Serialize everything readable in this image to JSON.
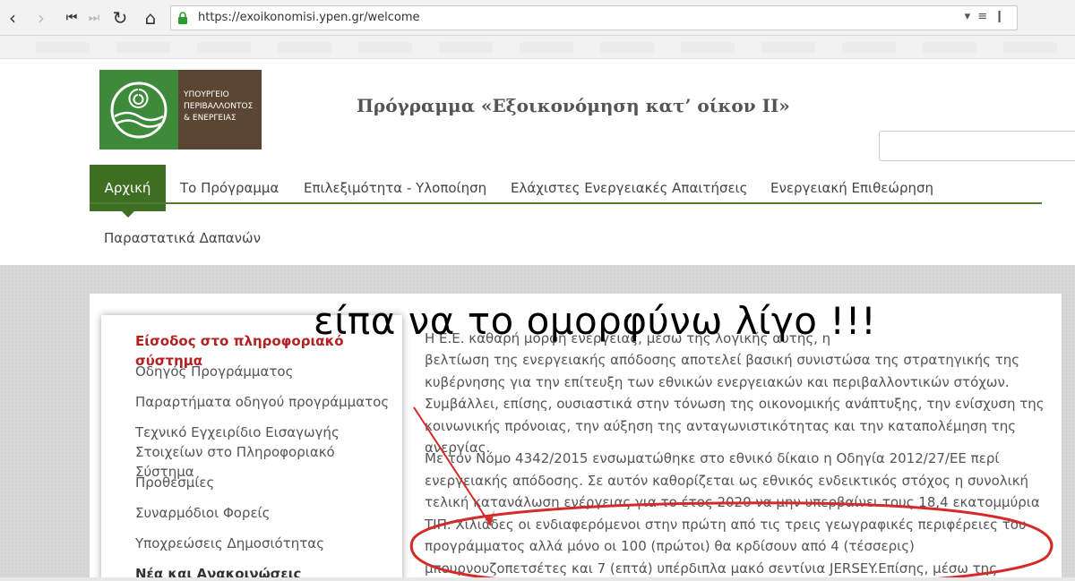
{
  "browser": {
    "url": "https://exoikonomisi.ypen.gr/welcome",
    "back_icon": "chevron-left-icon",
    "forward_icon": "chevron-right-icon"
  },
  "logo": {
    "line1": "ΥΠΟΥΡΓΕΙΟ",
    "line2": "ΠΕΡΙΒΑΛΛΟΝΤΟΣ",
    "line3": "& ΕΝΕΡΓΕΙΑΣ"
  },
  "site": {
    "title": "Πρόγραμμα «Εξοικονόμηση κατ’ οίκον ΙΙ»"
  },
  "menu": [
    {
      "label": "Αρχική",
      "active": true
    },
    {
      "label": "Το Πρόγραμμα"
    },
    {
      "label": "Επιλεξιμότητα - Υλοποίηση"
    },
    {
      "label": "Ελάχιστες Ενεργειακές Απαιτήσεις"
    },
    {
      "label": "Ενεργειακή Επιθεώρηση"
    },
    {
      "label": "Παραστατικά Δαπανών"
    }
  ],
  "sidebar": [
    {
      "label": "Είσοδος στο πληροφοριακό σύστημα",
      "active": true
    },
    {
      "label": "Οδηγός Προγράμματος"
    },
    {
      "label": "Παραρτήματα οδηγού προγράμματος"
    },
    {
      "label": "Τεχνικό Εγχειρίδιο Εισαγωγής Στοιχείων στο Πληροφοριακό Σύστημα"
    },
    {
      "label": "Προθεσμίες"
    },
    {
      "label": "Συναρμόδιοι Φορείς"
    },
    {
      "label": "Υποχρεώσεις Δημοσιότητας"
    },
    {
      "label": "Νέα και Ανακοινώσεις"
    }
  ],
  "content": {
    "p1_line1": "Η Ε.Ε. καθαρή μορφή ενέργειας, μέσω της λογικής αυτής, η",
    "p1_rest": "βελτίωση της ενεργειακής απόδοσης αποτελεί βασική συνιστώσα της στρατηγικής της κυβέρνησης για την επίτευξη των εθνικών ενεργειακών και περιβαλλοντικών στόχων. Συμβάλλει, επίσης, ουσιαστικά στην τόνωση της οικονομικής ανάπτυξης, την ενίσχυση της κοινωνικής πρόνοιας, την αύξηση της ανταγωνιστικότητας και την καταπολέμηση της ανεργίας.",
    "p2": "Με τον Νόμο 4342/2015 ενσωματώθηκε στο εθνικό δίκαιο η Οδηγία 2012/27/ΕΕ περί ενεργειακής απόδοσης. Σε αυτόν καθορίζεται ως εθνικός ενδεικτικός στόχος η συνολική τελική κατανάλωση ενέργειας για το έτος 2020 να μην υπερβαίνει τους 18,4 εκατομμύρια ΤΙΠ. Χιλιάδες οι ενδιαφερόμενοι στην πρώτη από τις τρεις γεωγραφικές περιφέρειες του προγράμματος αλλά μόνο οι 100 (πρώτοι) θα κρδίσουν από 4 (τέσσερις) μπουρνουζοπετσέτες και 7 (επτά) υπέρδιπλα μακό σεντίνια JERSEY.Επίσης, μέσω της εφαρμογής συγκεκριμένων"
  },
  "overlay": {
    "text": "είπα να το ομορφύνω λίγο !!!",
    "color": "#d42a2a"
  }
}
